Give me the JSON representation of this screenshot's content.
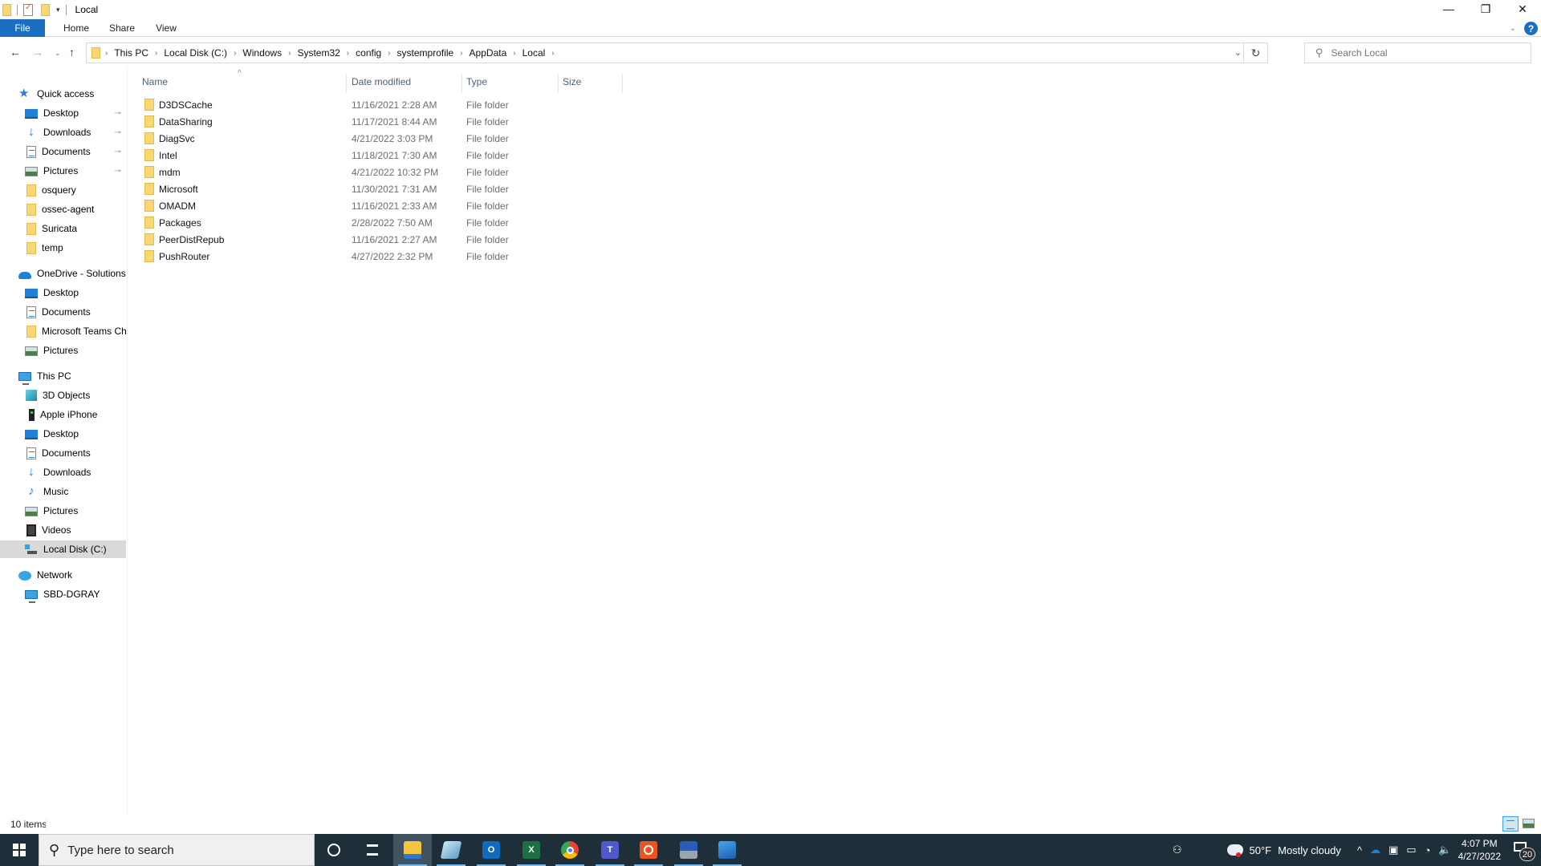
{
  "window": {
    "title": "Local",
    "controls": {
      "minimize": "—",
      "maximize": "❐",
      "close": "✕"
    }
  },
  "quick_access_toolbar": {
    "items": [
      {
        "icon": "folder-icon",
        "label": ""
      },
      {
        "icon": "properties-icon",
        "label": ""
      },
      {
        "icon": "new-folder-icon",
        "label": ""
      },
      {
        "icon": "customize-dropdown-icon",
        "label": "▾"
      }
    ]
  },
  "ribbon": {
    "tabs": [
      {
        "label": "File",
        "active": true
      },
      {
        "label": "Home"
      },
      {
        "label": "Share"
      },
      {
        "label": "View"
      }
    ],
    "expand_chevron": "⌄",
    "help": "?"
  },
  "navigation": {
    "back": "←",
    "forward": "→",
    "recent": "⌄",
    "up": "↑",
    "breadcrumb": [
      "This PC",
      "Local Disk (C:)",
      "Windows",
      "System32",
      "config",
      "systemprofile",
      "AppData",
      "Local"
    ],
    "separator": "›",
    "dropdown": "⌄",
    "refresh": "↻"
  },
  "search": {
    "placeholder": "Search Local",
    "value": "",
    "icon": "⚲"
  },
  "sidebar": {
    "quick_access": {
      "label": "Quick access",
      "items": [
        {
          "label": "Desktop",
          "icon": "desktop",
          "pinned": true
        },
        {
          "label": "Downloads",
          "icon": "downloads",
          "pinned": true
        },
        {
          "label": "Documents",
          "icon": "documents",
          "pinned": true
        },
        {
          "label": "Pictures",
          "icon": "pictures",
          "pinned": true
        },
        {
          "label": "osquery",
          "icon": "folder",
          "pinned": false
        },
        {
          "label": "ossec-agent",
          "icon": "folder",
          "pinned": false
        },
        {
          "label": "Suricata",
          "icon": "folder",
          "pinned": false
        },
        {
          "label": "temp",
          "icon": "folder",
          "pinned": false
        }
      ]
    },
    "onedrive": {
      "label": "OneDrive - Solutions",
      "items": [
        {
          "label": "Desktop",
          "icon": "desktop"
        },
        {
          "label": "Documents",
          "icon": "documents"
        },
        {
          "label": "Microsoft Teams Ch",
          "icon": "folder"
        },
        {
          "label": "Pictures",
          "icon": "pictures"
        }
      ]
    },
    "this_pc": {
      "label": "This PC",
      "items": [
        {
          "label": "3D Objects",
          "icon": "3d-objects"
        },
        {
          "label": "Apple iPhone",
          "icon": "phone"
        },
        {
          "label": "Desktop",
          "icon": "desktop"
        },
        {
          "label": "Documents",
          "icon": "documents"
        },
        {
          "label": "Downloads",
          "icon": "downloads"
        },
        {
          "label": "Music",
          "icon": "music"
        },
        {
          "label": "Pictures",
          "icon": "pictures"
        },
        {
          "label": "Videos",
          "icon": "videos"
        },
        {
          "label": "Local Disk (C:)",
          "icon": "local-disk",
          "selected": true
        }
      ]
    },
    "network": {
      "label": "Network",
      "items": [
        {
          "label": "SBD-DGRAY",
          "icon": "computer"
        }
      ]
    },
    "pin_glyph": "📌"
  },
  "file_list": {
    "columns": [
      "Name",
      "Date modified",
      "Type",
      "Size"
    ],
    "sort_indicator": "^",
    "rows": [
      {
        "name": "D3DSCache",
        "date": "11/16/2021 2:28 AM",
        "type": "File folder",
        "size": ""
      },
      {
        "name": "DataSharing",
        "date": "11/17/2021 8:44 AM",
        "type": "File folder",
        "size": ""
      },
      {
        "name": "DiagSvc",
        "date": "4/21/2022 3:03 PM",
        "type": "File folder",
        "size": ""
      },
      {
        "name": "Intel",
        "date": "11/18/2021 7:30 AM",
        "type": "File folder",
        "size": ""
      },
      {
        "name": "mdm",
        "date": "4/21/2022 10:32 PM",
        "type": "File folder",
        "size": ""
      },
      {
        "name": "Microsoft",
        "date": "11/30/2021 7:31 AM",
        "type": "File folder",
        "size": ""
      },
      {
        "name": "OMADM",
        "date": "11/16/2021 2:33 AM",
        "type": "File folder",
        "size": ""
      },
      {
        "name": "Packages",
        "date": "2/28/2022 7:50 AM",
        "type": "File folder",
        "size": ""
      },
      {
        "name": "PeerDistRepub",
        "date": "11/16/2021 2:27 AM",
        "type": "File folder",
        "size": ""
      },
      {
        "name": "PushRouter",
        "date": "4/27/2022 2:32 PM",
        "type": "File folder",
        "size": ""
      }
    ]
  },
  "status_bar": {
    "item_count": "10 items"
  },
  "taskbar": {
    "search_placeholder": "Type here to search",
    "apps": [
      {
        "name": "File Explorer",
        "active": true
      },
      {
        "name": "Notepad"
      },
      {
        "name": "Outlook",
        "glyph": "O",
        "color": "#0f6cbd"
      },
      {
        "name": "Excel",
        "glyph": "X",
        "color": "#1d7044"
      },
      {
        "name": "Chrome"
      },
      {
        "name": "Teams",
        "glyph": "T",
        "color": "#5059c9"
      },
      {
        "name": "Ubuntu",
        "color": "#e95420"
      },
      {
        "name": "Remote Desktop"
      },
      {
        "name": "Photos",
        "color": "#2b78d4"
      }
    ],
    "weather": {
      "temperature": "50°F",
      "condition": "Mostly cloudy"
    },
    "tray_icons": [
      "people",
      "show-hidden",
      "onedrive",
      "network-status",
      "battery",
      "wifi",
      "volume"
    ],
    "clock": {
      "time": "4:07 PM",
      "date": "4/27/2022"
    },
    "notifications": "20"
  }
}
